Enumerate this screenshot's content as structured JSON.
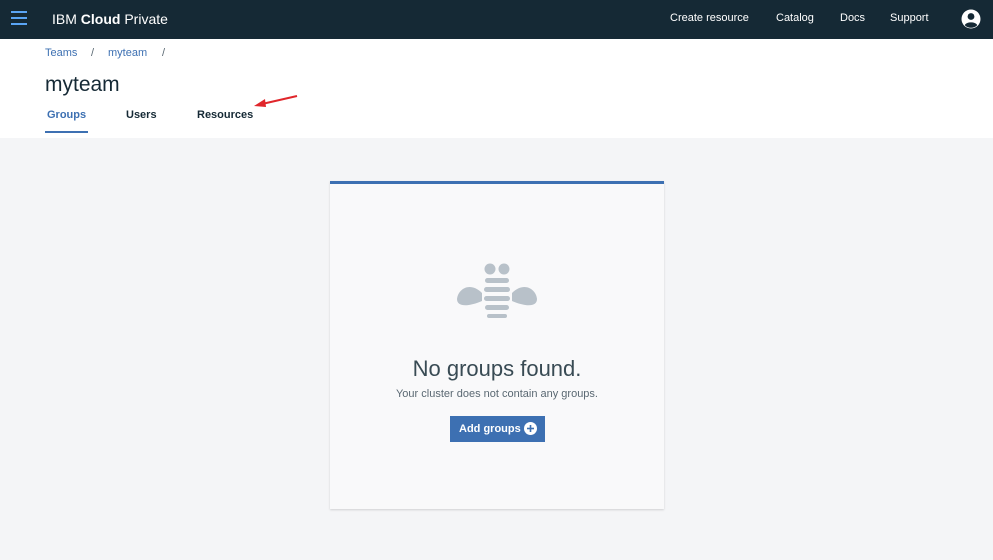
{
  "header": {
    "brand_prefix": "IBM",
    "brand_bold": "Cloud",
    "brand_suffix": "Private",
    "nav": [
      "Create resource",
      "Catalog",
      "Docs",
      "Support"
    ],
    "menu_icon": "hamburger-menu-icon",
    "user_icon": "user-avatar-icon"
  },
  "breadcrumb": {
    "items": [
      "Teams",
      "myteam"
    ],
    "separator": "/"
  },
  "page": {
    "title": "myteam",
    "tabs": [
      "Groups",
      "Users",
      "Resources"
    ],
    "active_tab": "Groups"
  },
  "empty_state": {
    "icon": "bee-icon",
    "title": "No groups found.",
    "subtitle": "Your cluster does not contain any groups.",
    "button_label": "Add groups",
    "button_icon": "add-circle-icon"
  },
  "annotation": {
    "icon": "red-arrow-icon",
    "color": "#e0262b"
  },
  "colors": {
    "header_bg": "#152935",
    "accent": "#3d70b2",
    "page_bg": "#f4f5f7"
  }
}
